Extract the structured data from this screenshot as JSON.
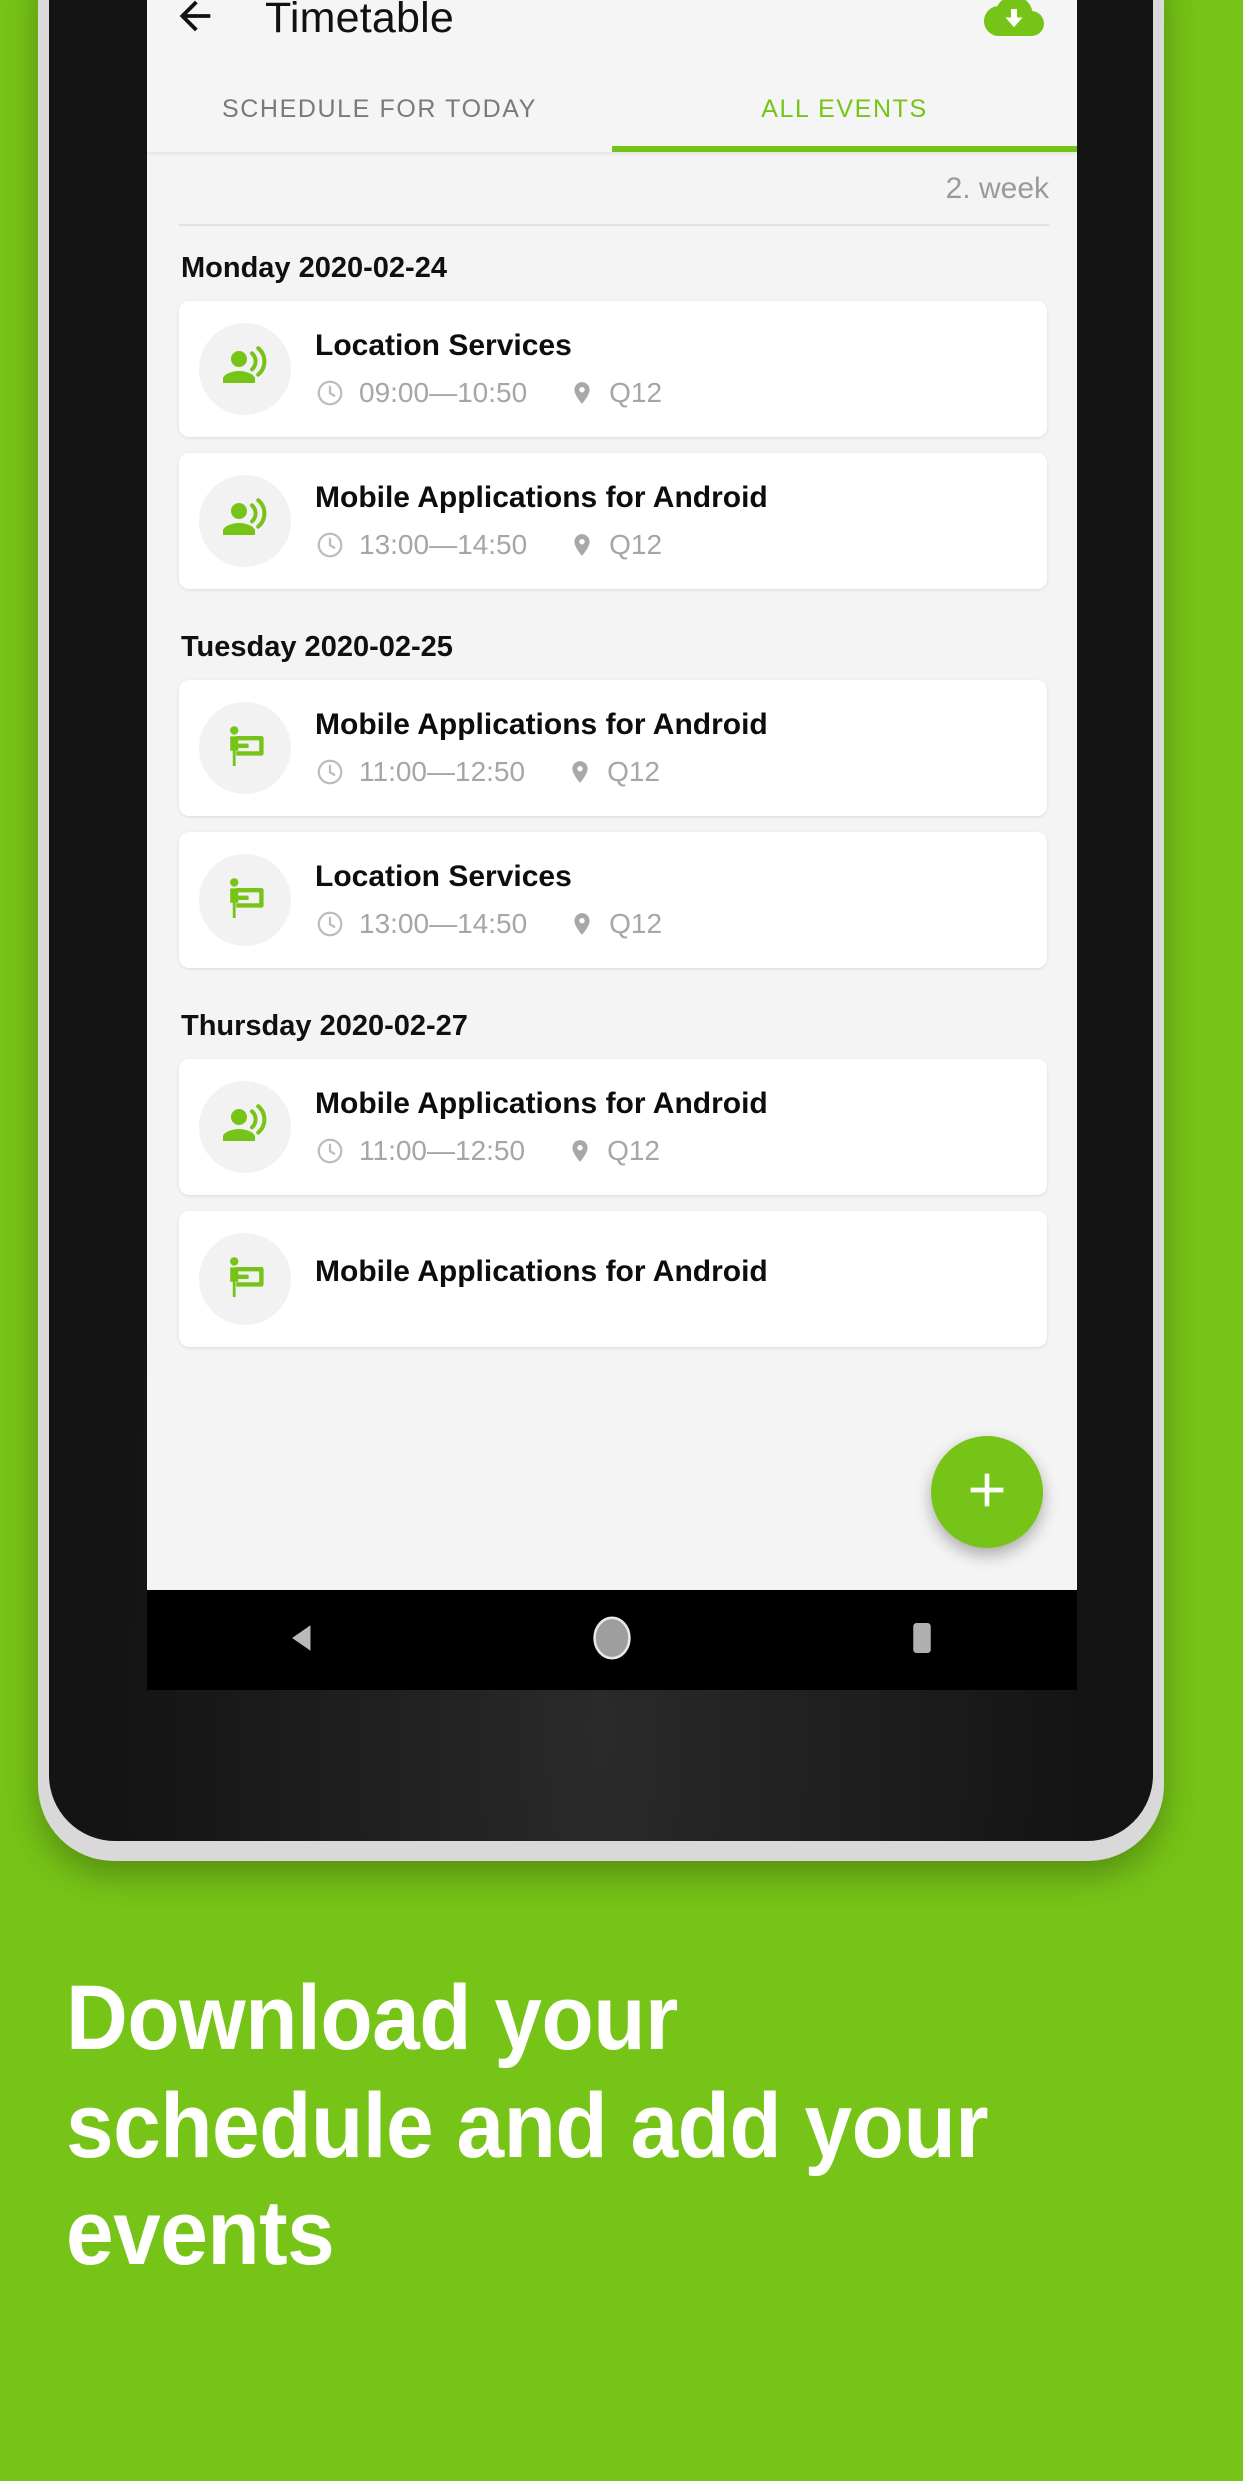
{
  "colors": {
    "brand_green": "#76C417",
    "screen_bg": "#f4f4f4",
    "card_white": "#ffffff",
    "muted_gray": "#a6a6a6",
    "tab_inactive": "#7a7a7a"
  },
  "app_bar": {
    "back_icon": "arrow-back-icon",
    "title": "Timetable",
    "download_icon": "cloud-download-icon"
  },
  "tabs": [
    {
      "label": "SCHEDULE FOR TODAY",
      "active": false
    },
    {
      "label": "ALL EVENTS",
      "active": true
    }
  ],
  "week_label": "2. week",
  "icons": {
    "clock": "clock-icon",
    "place": "place-pin-icon",
    "lecture": "record-voice-over-icon",
    "exercise": "presentation-board-icon",
    "fab": "plus-icon",
    "nav_back": "nav-back-triangle-icon",
    "nav_home": "nav-home-circle-icon",
    "nav_recents": "nav-recents-square-icon"
  },
  "days": [
    {
      "header": "Monday 2020-02-24",
      "events": [
        {
          "icon": "record-voice-over-icon",
          "title": "Location Services",
          "time": "09:00—10:50",
          "room": "Q12"
        },
        {
          "icon": "record-voice-over-icon",
          "title": "Mobile Applications for Android",
          "time": "13:00—14:50",
          "room": "Q12"
        }
      ]
    },
    {
      "header": "Tuesday 2020-02-25",
      "events": [
        {
          "icon": "presentation-board-icon",
          "title": "Mobile Applications for Android",
          "time": "11:00—12:50",
          "room": "Q12"
        },
        {
          "icon": "presentation-board-icon",
          "title": "Location Services",
          "time": "13:00—14:50",
          "room": "Q12"
        }
      ]
    },
    {
      "header": "Thursday 2020-02-27",
      "events": [
        {
          "icon": "record-voice-over-icon",
          "title": "Mobile Applications for Android",
          "time": "11:00—12:50",
          "room": "Q12"
        },
        {
          "icon": "presentation-board-icon",
          "title": "Mobile Applications for Android",
          "time": "",
          "room": ""
        }
      ]
    }
  ],
  "fab_label": "+",
  "tagline": "Download your schedule and add your events"
}
